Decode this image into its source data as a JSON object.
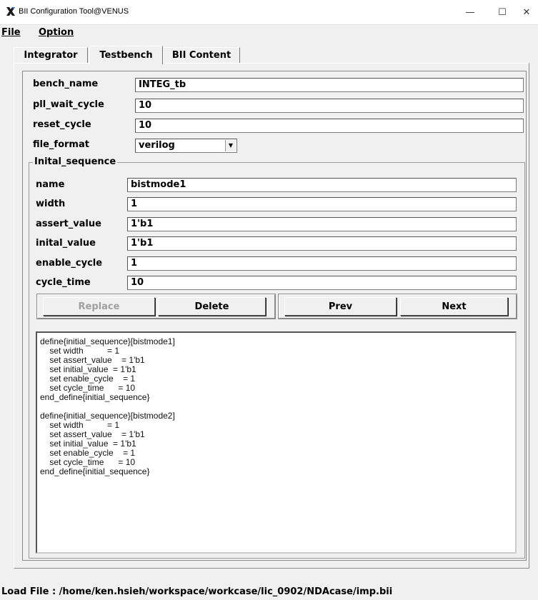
{
  "window": {
    "title": "BII Configuration Tool@VENUS",
    "minimize": "—",
    "maximize": "☐",
    "close": "✕",
    "icon": "x-logo-icon"
  },
  "menu": {
    "file_label": "File",
    "option_label": "Option"
  },
  "tabs": [
    {
      "label": "Integrator"
    },
    {
      "label": "Testbench"
    },
    {
      "label": "BII Content"
    }
  ],
  "testbench": {
    "bench_name": {
      "label": "bench_name",
      "value": "INTEG_tb"
    },
    "pll_wait_cycle": {
      "label": "pll_wait_cycle",
      "value": "10"
    },
    "reset_cycle": {
      "label": "reset_cycle",
      "value": "10"
    },
    "file_format": {
      "label": "file_format",
      "value": "verilog"
    }
  },
  "initial_sequence": {
    "group_title": "Inital_sequence",
    "name": {
      "label": "name",
      "value": "bistmode1"
    },
    "width": {
      "label": "width",
      "value": "1"
    },
    "assert_value": {
      "label": "assert_value",
      "value": "1'b1"
    },
    "inital_value": {
      "label": "inital_value",
      "value": "1'b1"
    },
    "enable_cycle": {
      "label": "enable_cycle",
      "value": "1"
    },
    "cycle_time": {
      "label": "cycle_time",
      "value": "10"
    }
  },
  "buttons": {
    "replace": "Replace",
    "delete": "Delete",
    "prev": "Prev",
    "next": "Next"
  },
  "content_lines": [
    "define{initial_sequence}[bistmode1]",
    "    set width          = 1",
    "    set assert_value    = 1'b1",
    "    set initial_value  = 1'b1",
    "    set enable_cycle    = 1",
    "    set cycle_time      = 10",
    "end_define{initial_sequence}",
    "",
    "define{initial_sequence}[bistmode2]",
    "    set width          = 1",
    "    set assert_value    = 1'b1",
    "    set initial_value  = 1'b1",
    "    set enable_cycle    = 1",
    "    set cycle_time      = 10",
    "end_define{initial_sequence}"
  ],
  "status": {
    "load_file": "Load File : /home/ken.hsieh/workspace/workcase/lic_0902/NDAcase/imp.bii"
  }
}
